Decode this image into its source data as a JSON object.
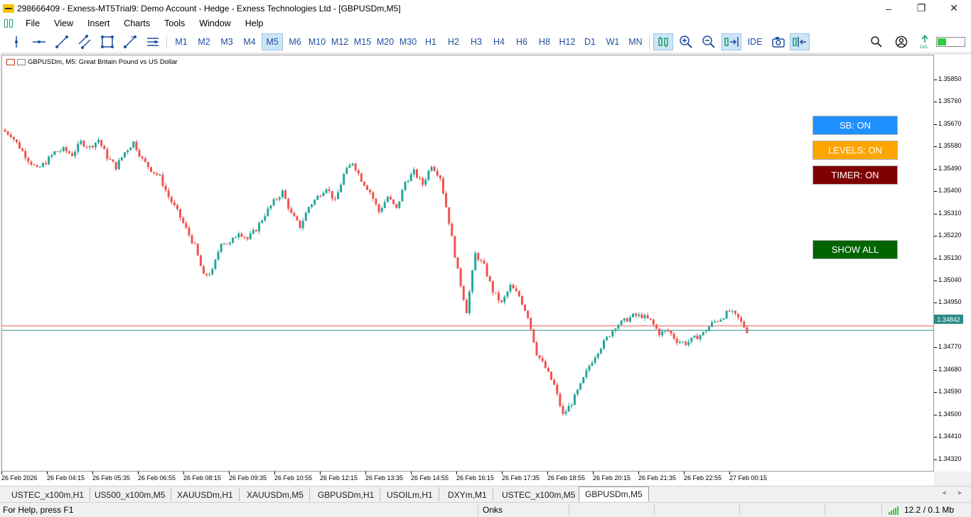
{
  "window": {
    "title": "298666409 - Exness-MT5Trial9: Demo Account - Hedge - Exness Technologies Ltd - [GBPUSDm,M5]",
    "controls": [
      "–",
      "❐",
      "✕"
    ]
  },
  "menu": [
    "File",
    "View",
    "Insert",
    "Charts",
    "Tools",
    "Window",
    "Help"
  ],
  "toolbar": {
    "drawing_tools": [
      "crosshair-icon",
      "horizontal-line-icon",
      "trendline-icon",
      "channel-icon",
      "shapes-icon",
      "fibonacci-icon",
      "objects-list-icon"
    ],
    "timeframes": [
      "M1",
      "M2",
      "M3",
      "M4",
      "M5",
      "M6",
      "M10",
      "M12",
      "M15",
      "M20",
      "M30",
      "H1",
      "H2",
      "H3",
      "H4",
      "H6",
      "H8",
      "H12",
      "D1",
      "W1",
      "MN"
    ],
    "active_timeframe": "M5",
    "ide_label": "IDE"
  },
  "chart": {
    "header": "GBPUSDm, M5:  Great Britain Pound vs US Dollar",
    "current_price": "1.34842",
    "price_labels": [
      "1.35850",
      "1.35760",
      "1.35670",
      "1.35580",
      "1.35490",
      "1.35400",
      "1.35310",
      "1.35220",
      "1.35130",
      "1.35040",
      "1.34950",
      "1.34770",
      "1.34680",
      "1.34590",
      "1.34500",
      "1.34410",
      "1.34320"
    ],
    "time_labels": [
      "26 Feb 2026",
      "26 Feb 04:15",
      "26 Feb 05:35",
      "26 Feb 06:55",
      "26 Feb 08:15",
      "26 Feb 09:35",
      "26 Feb 10:55",
      "26 Feb 12:15",
      "26 Feb 13:35",
      "26 Feb 14:55",
      "26 Feb 16:15",
      "26 Feb 17:35",
      "26 Feb 18:55",
      "26 Feb 20:15",
      "26 Feb 21:35",
      "26 Feb 22:55",
      "27 Feb 00:15"
    ],
    "ylim": [
      1.3427,
      1.3595
    ],
    "bull_color": "#26a69a",
    "bear_color": "#ef5350",
    "price_path": [
      1.3565,
      1.3563,
      1.3558,
      1.3553,
      1.3549,
      1.3552,
      1.3556,
      1.3557,
      1.3555,
      1.356,
      1.3558,
      1.3561,
      1.3554,
      1.355,
      1.3556,
      1.356,
      1.3553,
      1.3549,
      1.3546,
      1.3538,
      1.3532,
      1.3525,
      1.3518,
      1.3506,
      1.3508,
      1.352,
      1.3519,
      1.3524,
      1.3521,
      1.3525,
      1.3531,
      1.3536,
      1.354,
      1.3531,
      1.3526,
      1.3534,
      1.3538,
      1.3542,
      1.3536,
      1.3547,
      1.3552,
      1.3545,
      1.354,
      1.3532,
      1.3538,
      1.3533,
      1.3544,
      1.3548,
      1.3543,
      1.3551,
      1.3546,
      1.3528,
      1.3508,
      1.3492,
      1.3515,
      1.351,
      1.35,
      1.3495,
      1.3502,
      1.3498,
      1.349,
      1.3475,
      1.3469,
      1.3462,
      1.345,
      1.3455,
      1.3462,
      1.347,
      1.3476,
      1.3481,
      1.3486,
      1.3488,
      1.349,
      1.349,
      1.3488,
      1.3483,
      1.3484,
      1.348,
      1.3479,
      1.3481,
      1.3483,
      1.3487,
      1.3489,
      1.3492,
      1.3489,
      1.3484
    ],
    "objects": [
      {
        "label": "SB: ON",
        "color": "#1e90ff"
      },
      {
        "label": "LEVELS: ON",
        "color": "#ffa500"
      },
      {
        "label": "TIMER: ON",
        "color": "#800000"
      },
      {
        "label": "SHOW ALL",
        "color": "#006400"
      }
    ]
  },
  "symbol_tabs": [
    "USTEC_x100m,H1",
    "US500_x100m,M5",
    "XAUUSDm,H1",
    "XAUUSDm,M5",
    "GBPUSDm,H1",
    "USOILm,H1",
    "DXYm,M1",
    "USTEC_x100m,M5",
    "GBPUSDm,M5"
  ],
  "active_tab": "GBPUSDm,M5",
  "status": {
    "help": "For Help, press F1",
    "profile": "Onks",
    "traffic": "12.2 / 0.1 Mb"
  }
}
